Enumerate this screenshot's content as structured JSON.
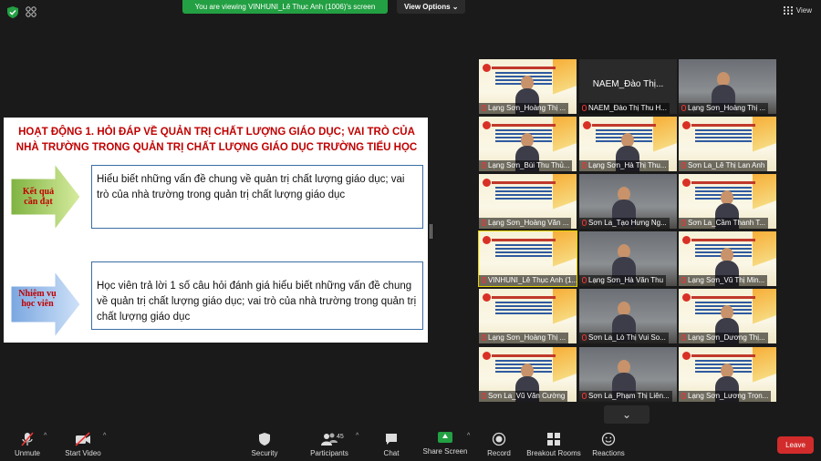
{
  "topbar": {
    "viewing_banner": "You are viewing VINHUNI_Lê Thục Anh (1006)'s screen",
    "view_options": "View Options",
    "view_label": "View"
  },
  "slide": {
    "title_line1": "HOẠT ĐỘNG 1. HỎI ĐÁP VỀ QUẢN TRỊ CHẤT LƯỢNG GIÁO DỤC; VAI TRÒ CỦA",
    "title_line2": "NHÀ TRƯỜNG TRONG QUẢN TRỊ CHẤT LƯỢNG GIÁO DỤC TRƯỜNG TIỂU HỌC",
    "arrow1": "Kết quả cần đạt",
    "arrow2": "Nhiệm vụ học viên",
    "box1": "Hiểu biết những vấn đề chung về quản trị chất lượng giáo dục; vai trò của nhà trường trong quản trị chất lượng giáo dục",
    "box2": "Học viên trả lời 1 số câu hỏi đánh giá hiểu biết những vấn đề chung về quản trị chất lượng giáo dục; vai trò của nhà trường trong quản trị chất lượng giáo dục"
  },
  "participants": [
    {
      "name": "Lạng Sơn_Hoàng Thị ...",
      "kind": "slide-person"
    },
    {
      "name": "NAEM_Đào Thị Thu H...",
      "big": "NAEM_Đào  Thị...",
      "kind": "black"
    },
    {
      "name": "Lạng Sơn_Hoàng Thị ...",
      "kind": "person-room"
    },
    {
      "name": "Lạng Sơn_Bùi Thu Thủ...",
      "kind": "slide-person"
    },
    {
      "name": "Lạng Sơn_Hà Thị Thu...",
      "kind": "slide-person"
    },
    {
      "name": "Sơn La_Lê Thị Lan Anh",
      "kind": "slide"
    },
    {
      "name": "Lạng Sơn_Hoàng Văn ...",
      "kind": "slide"
    },
    {
      "name": "Sơn La_Tạo Hưng Ng...",
      "kind": "person-room"
    },
    {
      "name": "Sơn La_Cầm Thanh T...",
      "kind": "slide-person"
    },
    {
      "name": "VINHUNI_Lê Thục Anh (1...",
      "kind": "slide",
      "active": true
    },
    {
      "name": "Lạng Sơn_Hà Văn Thu",
      "kind": "person-room"
    },
    {
      "name": "Lạng Sơn_Vũ Thị Min...",
      "kind": "slide-person"
    },
    {
      "name": "Lạng Sơn_Hoàng Thị ...",
      "kind": "slide"
    },
    {
      "name": "Sơn La_Lò Thị Vui So...",
      "kind": "person-room"
    },
    {
      "name": "Lạng Sơn_Dương Thị...",
      "kind": "slide-person"
    },
    {
      "name": "Sơn La_Vũ Văn Cường",
      "kind": "slide-person"
    },
    {
      "name": "Sơn La_Phạm Thị Liên...",
      "kind": "person-room"
    },
    {
      "name": "Lạng Sơn_Lương Trọn...",
      "kind": "slide-person"
    }
  ],
  "toolbar": {
    "unmute": "Unmute",
    "start_video": "Start Video",
    "security": "Security",
    "participants": "Participants",
    "participants_count": "45",
    "chat": "Chat",
    "share_screen": "Share Screen",
    "record": "Record",
    "breakout_rooms": "Breakout Rooms",
    "reactions": "Reactions",
    "leave": "Leave"
  },
  "colors": {
    "banner_green": "#23a043",
    "slide_title_red": "#c00000",
    "leave_red": "#d22b2b",
    "active_speaker": "#e6d200"
  }
}
